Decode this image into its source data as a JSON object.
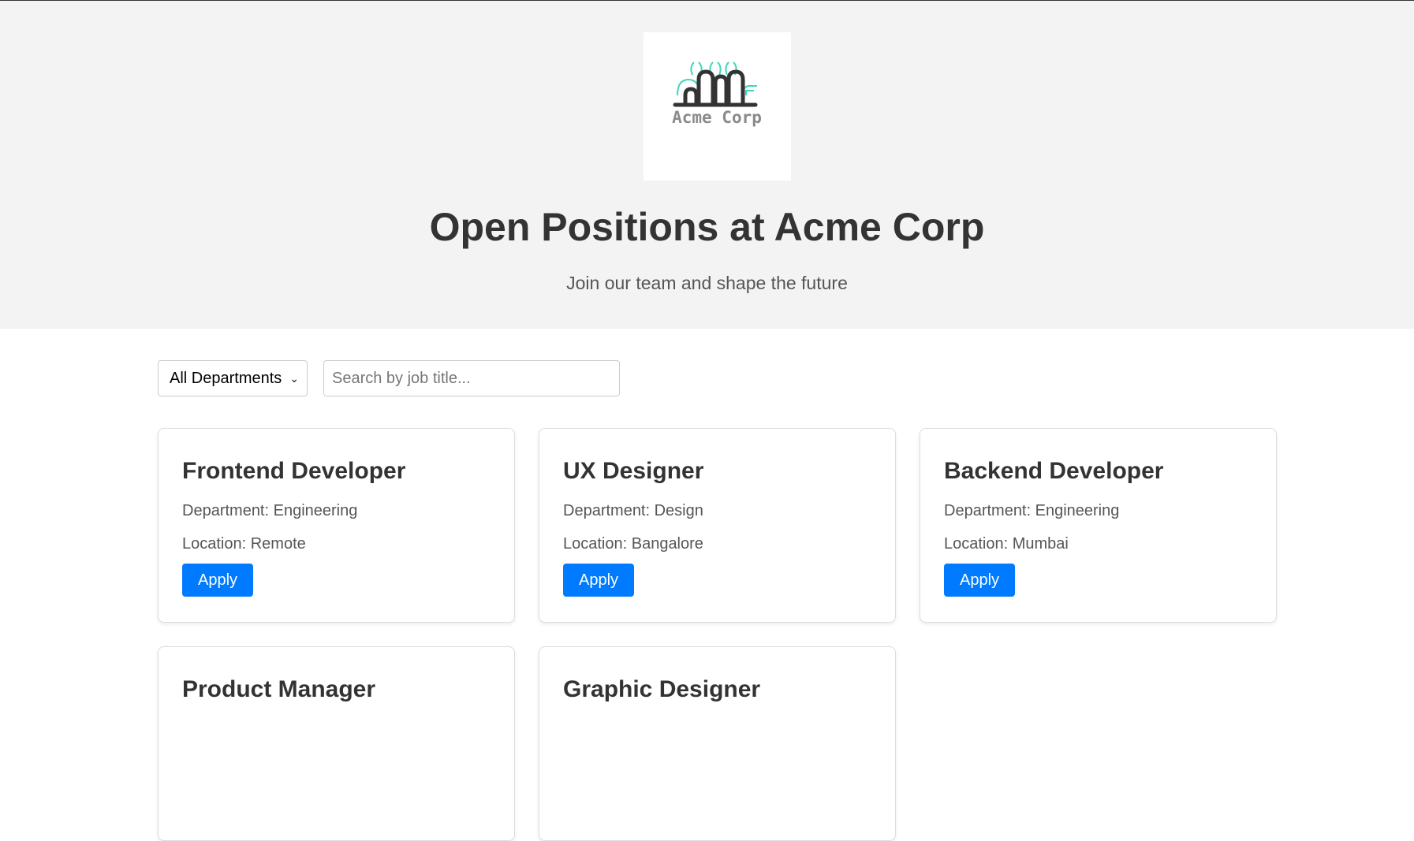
{
  "header": {
    "logo_text": "Acme Corp",
    "title": "Open Positions at Acme Corp",
    "subtitle": "Join our team and shape the future"
  },
  "filters": {
    "department_selected": "All Departments",
    "search_placeholder": "Search by job title..."
  },
  "jobs": [
    {
      "title": "Frontend Developer",
      "department": "Department: Engineering",
      "location": "Location: Remote",
      "apply_label": "Apply"
    },
    {
      "title": "UX Designer",
      "department": "Department: Design",
      "location": "Location: Bangalore",
      "apply_label": "Apply"
    },
    {
      "title": "Backend Developer",
      "department": "Department: Engineering",
      "location": "Location: Mumbai",
      "apply_label": "Apply"
    },
    {
      "title": "Product Manager",
      "department": "",
      "location": "",
      "apply_label": ""
    },
    {
      "title": "Graphic Designer",
      "department": "",
      "location": "",
      "apply_label": ""
    }
  ],
  "colors": {
    "accent": "#007bff",
    "logo_teal": "#3fd6b8",
    "hero_bg": "#f3f3f3"
  }
}
